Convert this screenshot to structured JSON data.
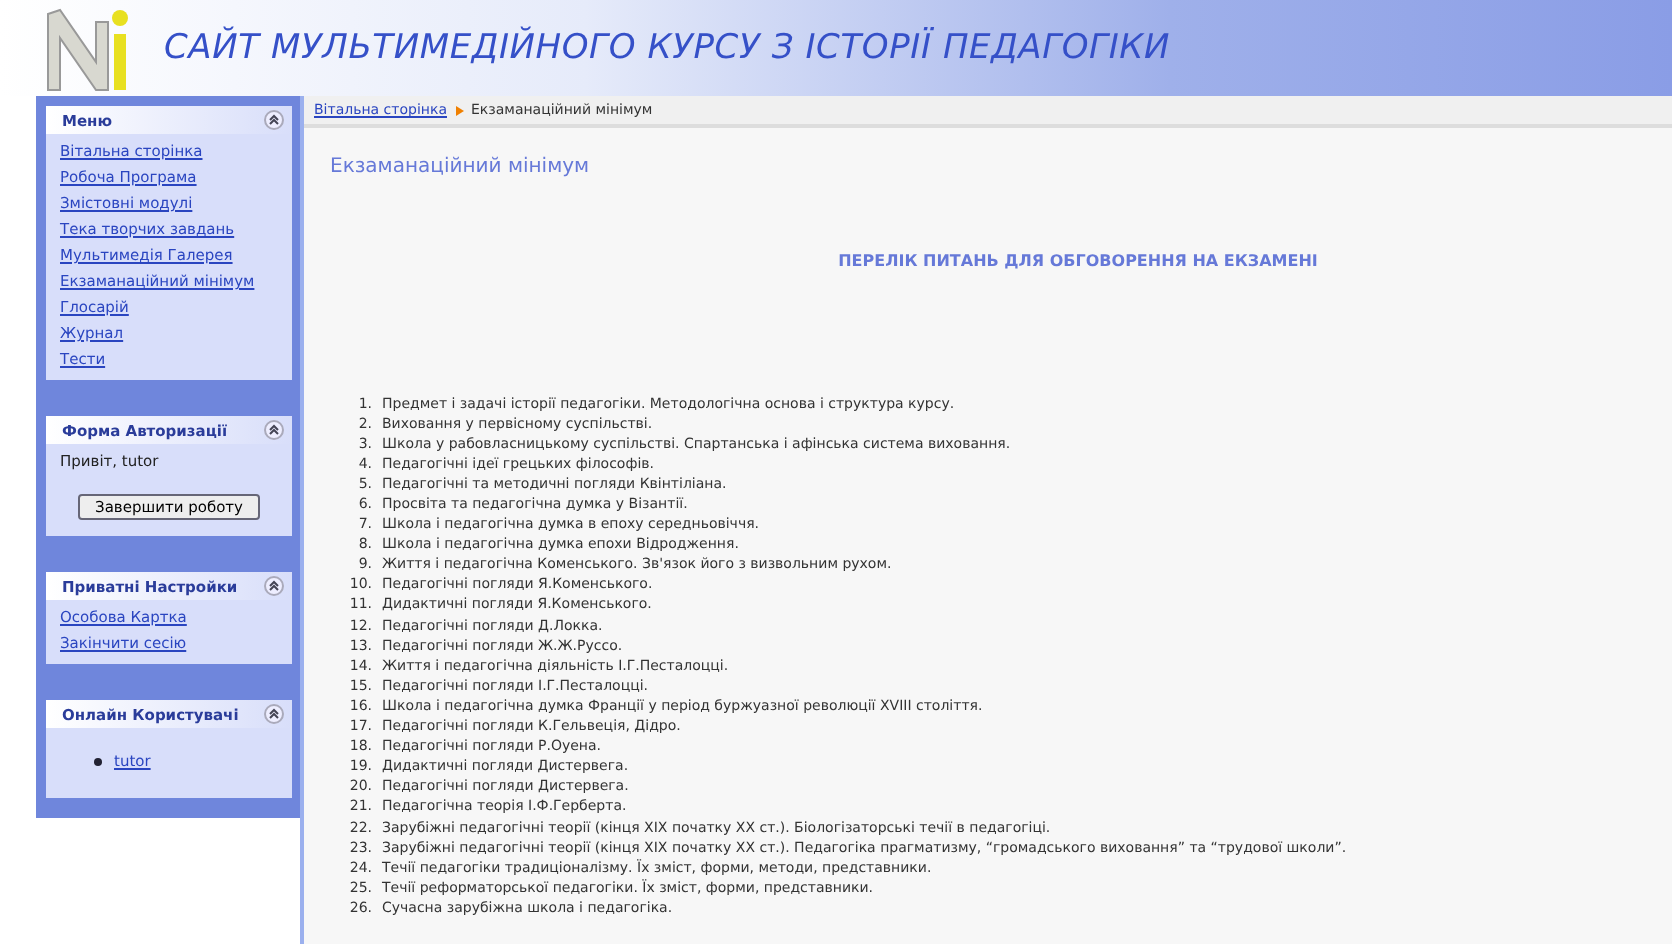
{
  "header": {
    "title": "САЙТ МУЛЬТИМЕДІЙНОГО КУРСУ З ІСТОРІЇ ПЕДАГОГІКИ"
  },
  "sidebar": {
    "blocks": [
      {
        "title": "Меню",
        "kind": "links",
        "links": [
          "Вітальна сторінка",
          "Робоча Програма",
          "Змістовні модулі",
          "Тека творчих завдань",
          "Мультимедія Галерея",
          "Екзаманаційний мінімум",
          "Глосарій",
          "Журнал",
          "Тести"
        ]
      },
      {
        "title": "Форма Авторизації",
        "kind": "login",
        "greeting": "Привіт, tutor",
        "button": "Завершити роботу"
      },
      {
        "title": "Приватні Настройки",
        "kind": "links",
        "links": [
          "Особова Картка",
          "Закінчити сесію"
        ]
      },
      {
        "title": "Онлайн Користувачі",
        "kind": "users",
        "users": [
          "tutor"
        ]
      }
    ]
  },
  "breadcrumb": {
    "home": "Вітальна сторінка",
    "current": "Екзаманаційний мінімум"
  },
  "page_title": "Екзаманаційний мінімум",
  "heading": "ПЕРЕЛІК ПИТАНЬ ДЛЯ ОБГОВОРЕННЯ НА ЕКЗАМЕНІ",
  "questions": [
    {
      "number": "1.",
      "text": "Предмет і задачі історії педагогіки. Методологічна основа і структура курсу."
    },
    {
      "number": "2.",
      "text": "Виховання у первісному суспільстві."
    },
    {
      "number": "3.",
      "text": "Школа у рабовласницькому суспільстві. Спартанська і афінська система виховання."
    },
    {
      "number": "4.",
      "text": "Педагогічні ідеї грецьких філософів."
    },
    {
      "number": "5.",
      "text": "Педагогічні та методичні погляди Квінтіліана."
    },
    {
      "number": "6.",
      "text": "Просвіта та педагогічна думка у Візантії."
    },
    {
      "number": "7.",
      "text": "Школа і педагогічна думка в епоху середньовіччя."
    },
    {
      "number": "8.",
      "text": "Школа і педагогічна думка епохи Відродження."
    },
    {
      "number": "9.",
      "text": "Життя і педагогічна Коменського. Зв'язок його з визвольним рухом."
    },
    {
      "number": "10.",
      "text": "Педагогічні погляди Я.Коменського."
    },
    {
      "number": "11.",
      "text": "Дидактичні погляди Я.Коменського."
    },
    {
      "number": "12.",
      "text": "Педагогічні погляди Д.Локка."
    },
    {
      "number": "13.",
      "text": "Педагогічні погляди Ж.Ж.Руссо."
    },
    {
      "number": "14.",
      "text": "Життя і педагогічна діяльність І.Г.Песталоцці."
    },
    {
      "number": "15.",
      "text": "Педагогічні погляди І.Г.Песталоцці."
    },
    {
      "number": "16.",
      "text": "Школа і педагогічна думка Франції у період буржуазної революції XVIII століття."
    },
    {
      "number": "17.",
      "text": "Педагогічні погляди К.Гельвеція, Дідро."
    },
    {
      "number": "18.",
      "text": "Педагогічні погляди Р.Оуена."
    },
    {
      "number": "19.",
      "text": "Дидактичні погляди Дистервега."
    },
    {
      "number": "20.",
      "text": "Педагогічні погляди Дистервега."
    },
    {
      "number": "21.",
      "text": "Педагогічна теорія І.Ф.Герберта."
    },
    {
      "number": "22.",
      "text": "Зарубіжні педагогічні теорії (кінця XIX початку XX ст.). Біологізаторські течії в педагогіці."
    },
    {
      "number": "23.",
      "text": "Зарубіжні педагогічні теорії (кінця XIX початку XX ст.). Педагогіка прагматизму, “громадського виховання” та “трудової школи”."
    },
    {
      "number": "24.",
      "text": "Течії педагогіки традиціоналізму. Їх зміст, форми, методи, представники."
    },
    {
      "number": "25.",
      "text": "Течії реформаторської педагогіки. Їх зміст, форми, представники."
    },
    {
      "number": "26.",
      "text": "Сучасна зарубіжна школа і педагогіка."
    }
  ]
}
